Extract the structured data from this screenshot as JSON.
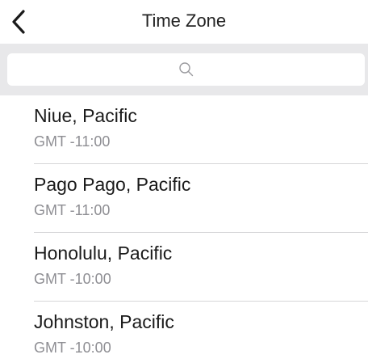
{
  "nav": {
    "title": "Time Zone",
    "back_icon": "chevron-left-icon"
  },
  "search": {
    "placeholder": "",
    "value": "",
    "icon": "search-icon"
  },
  "timezones": [
    {
      "city": "Niue, Pacific",
      "offset": "GMT -11:00"
    },
    {
      "city": "Pago Pago, Pacific",
      "offset": "GMT -11:00"
    },
    {
      "city": "Honolulu, Pacific",
      "offset": "GMT -10:00"
    },
    {
      "city": "Johnston, Pacific",
      "offset": "GMT -10:00"
    }
  ],
  "colors": {
    "background": "#ffffff",
    "search_bar_bg": "#e8e8ea",
    "secondary_text": "#8e8e93",
    "separator": "#d6d6d8"
  }
}
